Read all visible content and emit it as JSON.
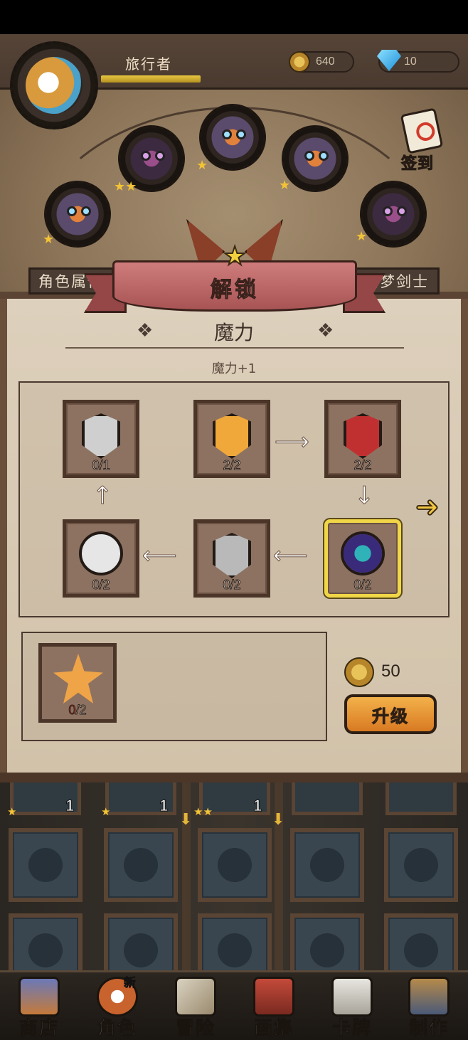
{
  "header": {
    "player_name": "旅行者",
    "coins": "640",
    "gems": "10",
    "checkin_label": "签到"
  },
  "tabs": {
    "left": "角色属性",
    "right": "猎梦剑士"
  },
  "unlock": {
    "banner_title": "解锁",
    "stat_name": "魔力",
    "stat_bonus": "魔力+1"
  },
  "skill_nodes": [
    {
      "icon": "star-shield-icon",
      "count": "0/1"
    },
    {
      "icon": "sword-shield-icon",
      "count": "2/2"
    },
    {
      "icon": "heart-shield-icon",
      "count": "2/2"
    },
    {
      "icon": "axe-sword-circle-icon",
      "count": "0/2"
    },
    {
      "icon": "plain-shield-icon",
      "count": "0/2"
    },
    {
      "icon": "swirl-orb-icon",
      "count": "0/2",
      "selected": true
    }
  ],
  "cost": {
    "item_icon": "star-cookie-icon",
    "have": "0",
    "need": "/2",
    "price": "50",
    "upgrade_label": "升级"
  },
  "inventory": {
    "counts": [
      "1",
      "1",
      "1"
    ]
  },
  "nav": {
    "items": [
      {
        "label": "商店",
        "icon": "castle-icon"
      },
      {
        "label": "角色",
        "icon": "cat-icon",
        "badge": "新"
      },
      {
        "label": "冒险",
        "icon": "crossed-swords-icon"
      },
      {
        "label": "画集",
        "icon": "book-icon"
      },
      {
        "label": "卡牌",
        "icon": "card-icon"
      },
      {
        "label": "制作",
        "icon": "anvil-icon"
      }
    ]
  },
  "colors": {
    "accent_gold": "#f1d648",
    "banner_red": "#b85c5c",
    "button_orange": "#e8932f",
    "missing_red": "#e23a2a"
  }
}
